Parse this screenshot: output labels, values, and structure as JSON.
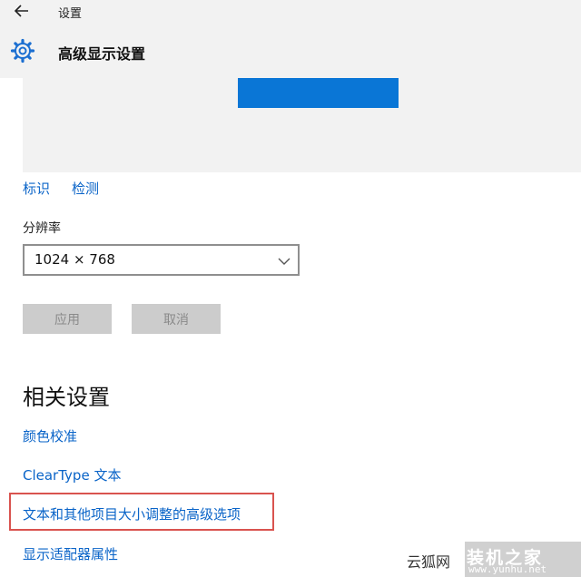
{
  "header": {
    "app_title": "设置",
    "page_title": "高级显示设置",
    "back_icon": "arrow-left-icon",
    "gear_icon": "gear-icon"
  },
  "preview": {
    "monitor_color": "#0a76d6"
  },
  "display_links": {
    "identify": "标识",
    "detect": "检测"
  },
  "resolution": {
    "label": "分辨率",
    "value": "1024 × 768"
  },
  "buttons": {
    "apply": "应用",
    "cancel": "取消"
  },
  "related": {
    "title": "相关设置",
    "items": [
      {
        "label": "颜色校准"
      },
      {
        "label": "ClearType 文本"
      },
      {
        "label": "文本和其他项目大小调整的高级选项"
      },
      {
        "label": "显示适配器属性"
      }
    ]
  },
  "watermark": {
    "site": "云狐网",
    "brand": "装机之家",
    "url": "www.yunhu.net"
  },
  "colors": {
    "link": "#0a64c8",
    "accent": "#0a76d6",
    "highlight": "#d9534f",
    "button_disabled": "#cccccc"
  }
}
